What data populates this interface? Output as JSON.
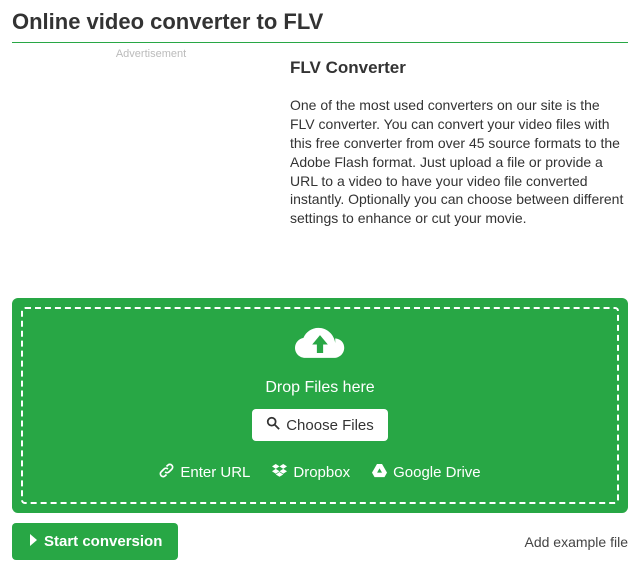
{
  "page": {
    "title": "Online video converter to FLV",
    "ad_label": "Advertisement",
    "section_heading": "FLV Converter",
    "description": "One of the most used converters on our site is the FLV converter. You can convert your video files with this free converter from over 45 source formats to the Adobe Flash format. Just upload a file or provide a URL to a video to have your video file converted instantly. Optionally you can choose between different settings to enhance or cut your movie."
  },
  "dropzone": {
    "drop_label": "Drop Files here",
    "choose_label": "Choose Files",
    "sources": {
      "url": "Enter URL",
      "dropbox": "Dropbox",
      "gdrive": "Google Drive"
    }
  },
  "actions": {
    "start": "Start conversion",
    "example": "Add example file"
  },
  "colors": {
    "accent": "#28a745"
  }
}
